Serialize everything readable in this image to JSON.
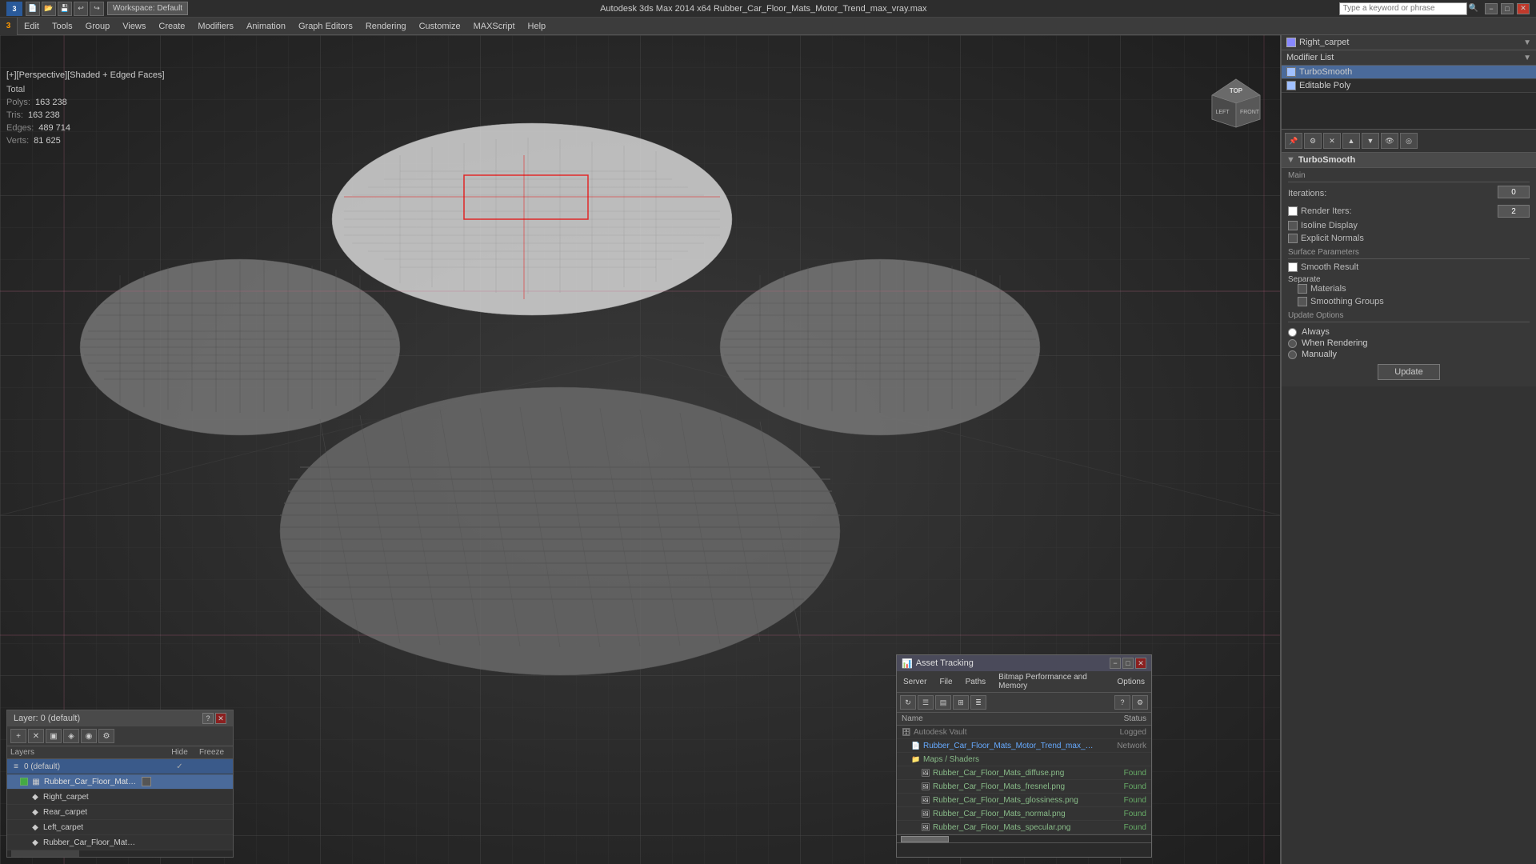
{
  "app": {
    "title": "Rubber_Car_Floor_Mats_Motor_Trend_max_vray.max",
    "workspace": "Workspace: Default",
    "search_placeholder": "Type a keyword or phrase"
  },
  "title_bar": {
    "title": "Autodesk 3ds Max 2014 x64     Rubber_Car_Floor_Mats_Motor_Trend_max_vray.max",
    "minimize": "−",
    "maximize": "□",
    "close": "✕"
  },
  "menu": {
    "items": [
      "Edit",
      "Tools",
      "Group",
      "Views",
      "Create",
      "Modifiers",
      "Animation",
      "Graph Editors",
      "Rendering",
      "Customize",
      "MAXScript",
      "Help"
    ]
  },
  "viewport": {
    "label": "[+][Perspective][Shaded + Edged Faces]",
    "stats": {
      "total_label": "Total",
      "polys_label": "Polys:",
      "polys_value": "163 238",
      "tris_label": "Tris:",
      "tris_value": "163 238",
      "edges_label": "Edges:",
      "edges_value": "489 714",
      "verts_label": "Verts:",
      "verts_value": "81 625"
    }
  },
  "right_panel": {
    "object_name": "Right_carpet",
    "modifier_list_label": "Modifier List",
    "modifiers": [
      {
        "name": "TurboSmooth",
        "checked": true
      },
      {
        "name": "Editable Poly",
        "checked": true
      }
    ],
    "turbosmooth": {
      "title": "TurboSmooth",
      "main_label": "Main",
      "iterations_label": "Iterations:",
      "iterations_value": "0",
      "render_iters_label": "Render Iters:",
      "render_iters_value": "2",
      "isoline_label": "Isoline Display",
      "explicit_normals_label": "Explicit Normals",
      "surface_params_label": "Surface Parameters",
      "smooth_result_label": "Smooth Result",
      "smooth_result_checked": true,
      "separate_label": "Separate",
      "materials_label": "Materials",
      "materials_checked": false,
      "smoothing_groups_label": "Smoothing Groups",
      "smoothing_groups_checked": false,
      "update_options_label": "Update Options",
      "always_label": "Always",
      "always_selected": true,
      "when_rendering_label": "When Rendering",
      "when_rendering_selected": false,
      "manually_label": "Manually",
      "manually_selected": false,
      "update_btn_label": "Update"
    }
  },
  "layers_panel": {
    "title": "Layer: 0 (default)",
    "layers_col": "Layers",
    "hide_col": "Hide",
    "freeze_col": "Freeze",
    "items": [
      {
        "indent": 0,
        "name": "0 (default)",
        "hide": "",
        "freeze": "",
        "active": true
      },
      {
        "indent": 1,
        "name": "Rubber_Car_Floor_Mats_Motor_Trend",
        "hide": "",
        "freeze": "",
        "selected": true
      },
      {
        "indent": 2,
        "name": "Right_carpet",
        "hide": "",
        "freeze": ""
      },
      {
        "indent": 2,
        "name": "Rear_carpet",
        "hide": "",
        "freeze": ""
      },
      {
        "indent": 2,
        "name": "Left_carpet",
        "hide": "",
        "freeze": ""
      },
      {
        "indent": 2,
        "name": "Rubber_Car_Floor_Mats_Motor_Trend",
        "hide": "",
        "freeze": ""
      }
    ]
  },
  "asset_tracking": {
    "title": "Asset Tracking",
    "menus": [
      "Server",
      "File",
      "Paths",
      "Bitmap Performance and Memory",
      "Options"
    ],
    "col_name": "Name",
    "col_status": "Status",
    "items": [
      {
        "indent": 0,
        "type": "folder",
        "name": "Autodesk Vault",
        "status": "Logged",
        "status_class": "status-logged"
      },
      {
        "indent": 1,
        "type": "file",
        "name": "Rubber_Car_Floor_Mats_Motor_Trend_max_vray.max",
        "status": "Network",
        "status_class": "status-network"
      },
      {
        "indent": 1,
        "type": "folder",
        "name": "Maps / Shaders",
        "status": "",
        "status_class": ""
      },
      {
        "indent": 2,
        "type": "img",
        "name": "Rubber_Car_Floor_Mats_diffuse.png",
        "status": "Found",
        "status_class": "status-found"
      },
      {
        "indent": 2,
        "type": "img",
        "name": "Rubber_Car_Floor_Mats_fresnel.png",
        "status": "Found",
        "status_class": "status-found"
      },
      {
        "indent": 2,
        "type": "img",
        "name": "Rubber_Car_Floor_Mats_glossiness.png",
        "status": "Found",
        "status_class": "status-found"
      },
      {
        "indent": 2,
        "type": "img",
        "name": "Rubber_Car_Floor_Mats_normal.png",
        "status": "Found",
        "status_class": "status-found"
      },
      {
        "indent": 2,
        "type": "img",
        "name": "Rubber_Car_Floor_Mats_specular.png",
        "status": "Found",
        "status_class": "status-found"
      }
    ]
  }
}
